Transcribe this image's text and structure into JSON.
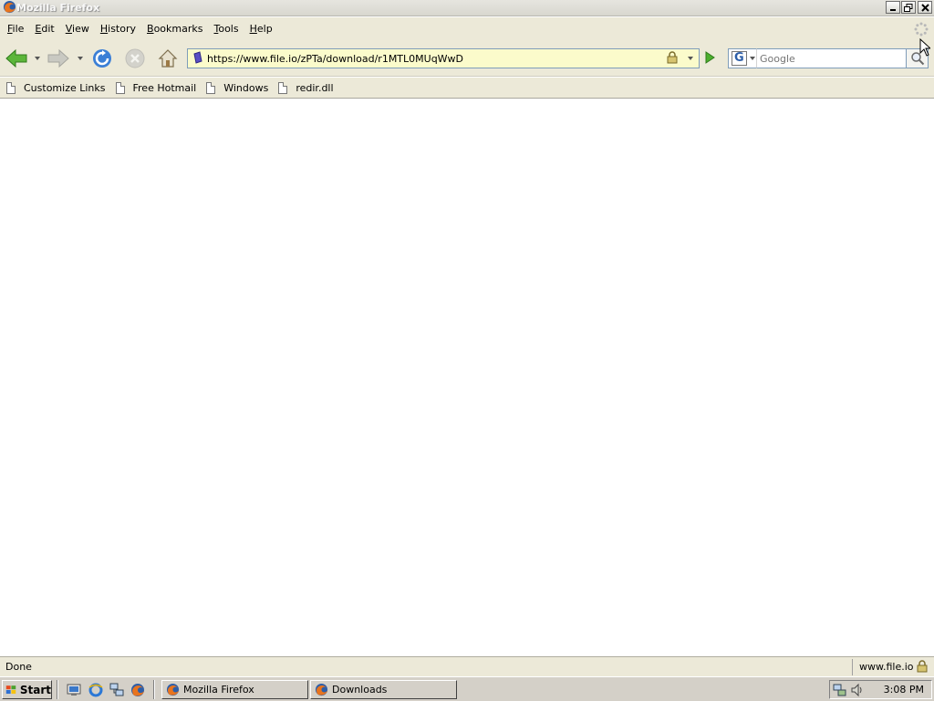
{
  "window": {
    "title": "Mozilla Firefox"
  },
  "menubar": {
    "items": [
      {
        "label": "File",
        "u": "F",
        "rest": "ile"
      },
      {
        "label": "Edit",
        "u": "E",
        "rest": "dit"
      },
      {
        "label": "View",
        "u": "V",
        "rest": "iew"
      },
      {
        "label": "History",
        "u": "H",
        "rest": "istory"
      },
      {
        "label": "Bookmarks",
        "u": "B",
        "rest": "ookmarks"
      },
      {
        "label": "Tools",
        "u": "T",
        "rest": "ools"
      },
      {
        "label": "Help",
        "u": "H",
        "rest": "elp"
      }
    ]
  },
  "navbar": {
    "url": "https://www.file.io/zPTa/download/r1MTL0MUqWwD",
    "search_placeholder": "Google",
    "search_engine": "G"
  },
  "bookmarks": {
    "items": [
      "Customize Links",
      "Free Hotmail",
      "Windows",
      "redir.dll"
    ]
  },
  "statusbar": {
    "text": "Done",
    "domain": "www.file.io"
  },
  "taskbar": {
    "start_label": "Start",
    "tasks": [
      "Mozilla Firefox",
      "Downloads"
    ],
    "clock": "3:08 PM"
  },
  "colors": {
    "accent": "#ece9d8",
    "urlbar_secure": "#fbfbcb",
    "back_green": "#4caf2e"
  },
  "icons": [
    "firefox-icon",
    "minimize-icon",
    "maximize-icon",
    "close-icon",
    "back-arrow-icon",
    "forward-arrow-icon",
    "reload-icon",
    "stop-icon",
    "home-icon",
    "site-identity-icon",
    "padlock-icon",
    "go-arrow-icon",
    "google-icon",
    "magnifier-icon",
    "page-icon",
    "throbber-icon",
    "windows-flag-icon",
    "network-icon",
    "speaker-icon"
  ]
}
